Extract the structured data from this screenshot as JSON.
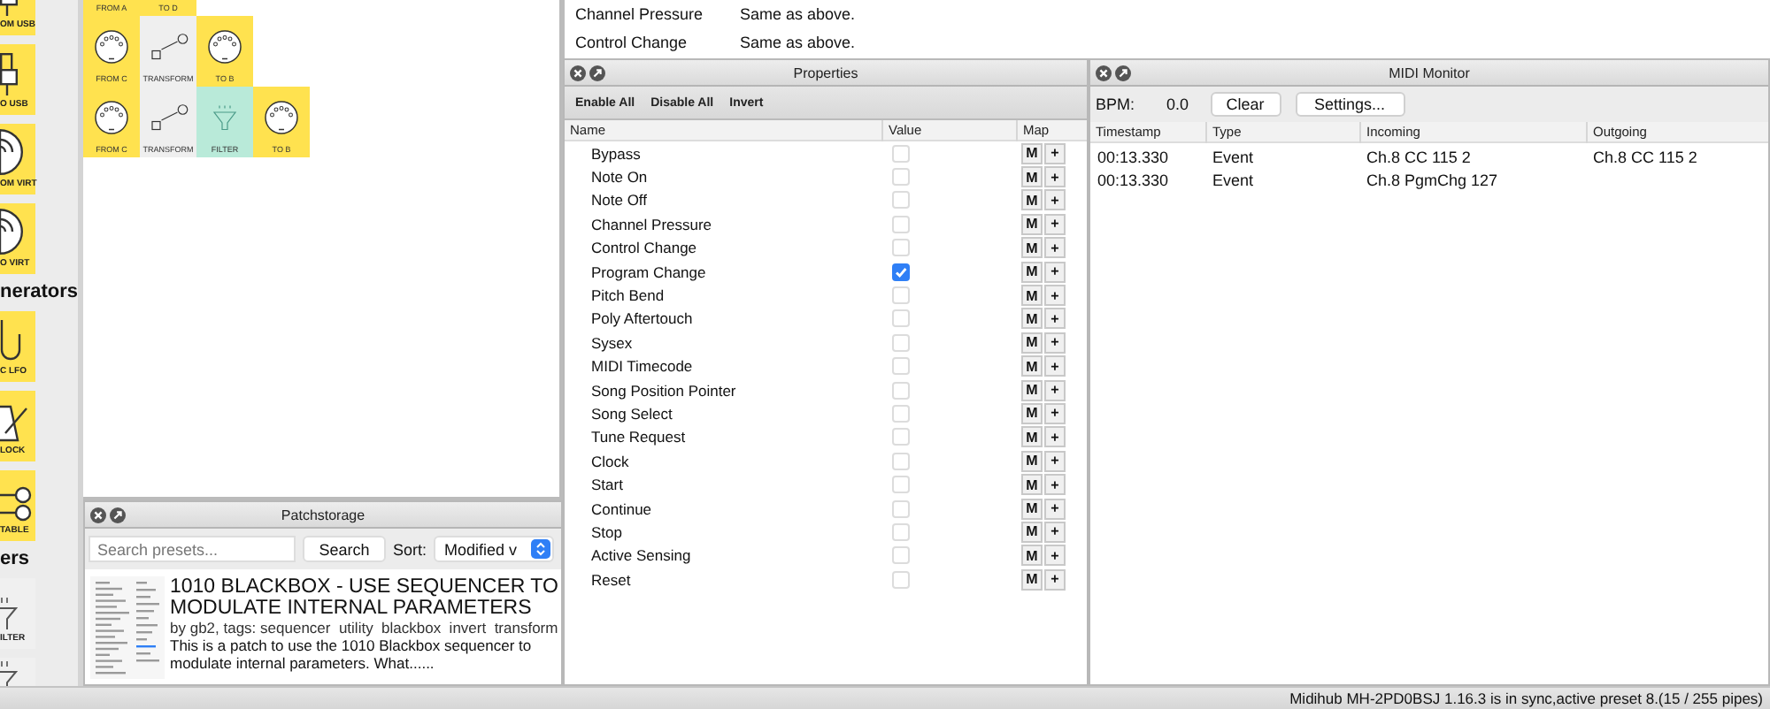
{
  "sidebar": {
    "sections": [
      {
        "tiles": [
          {
            "kind": "usb",
            "label": "OM USB"
          },
          {
            "kind": "usb",
            "label": "O USB"
          },
          {
            "kind": "virt",
            "label": "OM VIRT"
          },
          {
            "kind": "virt",
            "label": "O VIRT"
          }
        ]
      },
      {
        "heading": "nerators",
        "tiles": [
          {
            "kind": "lfo",
            "label": "C LFO"
          },
          {
            "kind": "clock",
            "label": "LOCK"
          },
          {
            "kind": "table",
            "label": "TABLE"
          }
        ]
      },
      {
        "heading": "ers",
        "tiles": [
          {
            "kind": "filter",
            "label": "ILTER"
          },
          {
            "kind": "filter"
          }
        ]
      }
    ]
  },
  "canvas": {
    "rows": [
      [
        {
          "kind": "midi",
          "label": "FROM A"
        },
        {
          "kind": "midi",
          "label": "TO D"
        }
      ],
      [
        {
          "kind": "midi",
          "label": "FROM C"
        },
        {
          "kind": "transform",
          "label": "TRANSFORM"
        },
        {
          "kind": "midi",
          "label": "TO B"
        }
      ],
      [
        {
          "kind": "midi",
          "label": "FROM C"
        },
        {
          "kind": "transform",
          "label": "TRANSFORM"
        },
        {
          "kind": "filter",
          "label": "FILTER"
        },
        {
          "kind": "midi",
          "label": "TO B"
        }
      ]
    ]
  },
  "patchstorage": {
    "title": "Patchstorage",
    "search_placeholder": "Search presets...",
    "search_button": "Search",
    "sort_label": "Sort:",
    "sort_value": "Modified v",
    "result": {
      "title": "1010 BLACKBOX - USE SEQUENCER TO MODULATE INTERNAL PARAMETERS",
      "meta": "by gb2, tags: sequencer  utility  blackbox  invert  transform",
      "description": "This is a patch to use the 1010 Blackbox sequencer to modulate internal parameters. What......"
    }
  },
  "info": [
    {
      "name": "Channel Pressure",
      "value": "Same as above."
    },
    {
      "name": "Control Change",
      "value": "Same as above."
    }
  ],
  "properties": {
    "title": "Properties",
    "toolbar": [
      "Enable All",
      "Disable All",
      "Invert"
    ],
    "columns": [
      "Name",
      "Value",
      "Map"
    ],
    "rows": [
      {
        "name": "Bypass",
        "checked": false,
        "map": [
          "M",
          "+"
        ]
      },
      {
        "name": "Note On",
        "checked": false,
        "map": [
          "M",
          "+"
        ]
      },
      {
        "name": "Note Off",
        "checked": false,
        "map": [
          "M",
          "+"
        ]
      },
      {
        "name": "Channel Pressure",
        "checked": false,
        "map": [
          "M",
          "+"
        ]
      },
      {
        "name": "Control Change",
        "checked": false,
        "map": [
          "M",
          "+"
        ]
      },
      {
        "name": "Program Change",
        "checked": true,
        "map": [
          "M",
          "+"
        ]
      },
      {
        "name": "Pitch Bend",
        "checked": false,
        "map": [
          "M",
          "+"
        ]
      },
      {
        "name": "Poly Aftertouch",
        "checked": false,
        "map": [
          "M",
          "+"
        ]
      },
      {
        "name": "Sysex",
        "checked": false,
        "map": [
          "M",
          "+"
        ]
      },
      {
        "name": "MIDI Timecode",
        "checked": false,
        "map": [
          "M",
          "+"
        ]
      },
      {
        "name": "Song Position Pointer",
        "checked": false,
        "map": [
          "M",
          "+"
        ]
      },
      {
        "name": "Song Select",
        "checked": false,
        "map": [
          "M",
          "+"
        ]
      },
      {
        "name": "Tune Request",
        "checked": false,
        "map": [
          "M",
          "+"
        ]
      },
      {
        "name": "Clock",
        "checked": false,
        "map": [
          "M",
          "+"
        ]
      },
      {
        "name": "Start",
        "checked": false,
        "map": [
          "M",
          "+"
        ]
      },
      {
        "name": "Continue",
        "checked": false,
        "map": [
          "M",
          "+"
        ]
      },
      {
        "name": "Stop",
        "checked": false,
        "map": [
          "M",
          "+"
        ]
      },
      {
        "name": "Active Sensing",
        "checked": false,
        "map": [
          "M",
          "+"
        ]
      },
      {
        "name": "Reset",
        "checked": false,
        "map": [
          "M",
          "+"
        ]
      }
    ]
  },
  "monitor": {
    "title": "MIDI Monitor",
    "bpm_label": "BPM:",
    "bpm_value": "0.0",
    "buttons": [
      "Clear",
      "Settings..."
    ],
    "columns": [
      "Timestamp",
      "Type",
      "Incoming",
      "Outgoing"
    ],
    "rows": [
      [
        "00:13.330",
        "Event",
        "Ch.8 CC 115 2",
        "Ch.8 CC 115 2"
      ],
      [
        "00:13.330",
        "Event",
        "Ch.8 PgmChg 127",
        ""
      ]
    ]
  },
  "status_bar": "Midihub MH-2PD0BSJ 1.16.3 is in sync,active preset 8.(15 / 255 pipes)"
}
